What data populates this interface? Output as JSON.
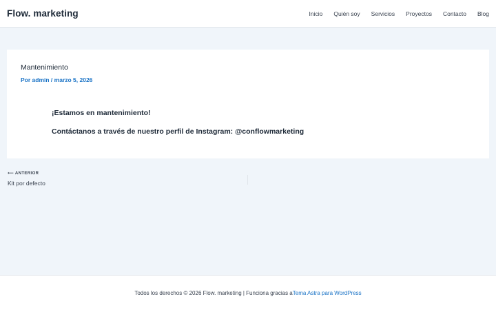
{
  "header": {
    "site_title": "Flow. marketing",
    "nav": [
      "Inicio",
      "Quién soy",
      "Servicios",
      "Proyectos",
      "Contacto",
      "Blog"
    ]
  },
  "post": {
    "title": "Mantenimiento",
    "meta_prefix": "Por ",
    "author": "admin",
    "separator": " / ",
    "date": "marzo 5, 2026",
    "content": [
      "¡Estamos en mantenimiento!",
      "Contáctanos a través de nuestro perfil de Instagram: @conflowmarketing"
    ]
  },
  "post_nav": {
    "prev_arrow": "⟵",
    "prev_label": "ANTERIOR",
    "prev_title": "Kit por defecto"
  },
  "footer": {
    "text": "Todos los derechos © 2026 Flow. marketing | Funciona gracias a ",
    "link": "Tema Astra para WordPress"
  },
  "colors": {
    "accent": "#1a73c6",
    "background": "#f0f5fa",
    "text": "#1e2a38"
  }
}
